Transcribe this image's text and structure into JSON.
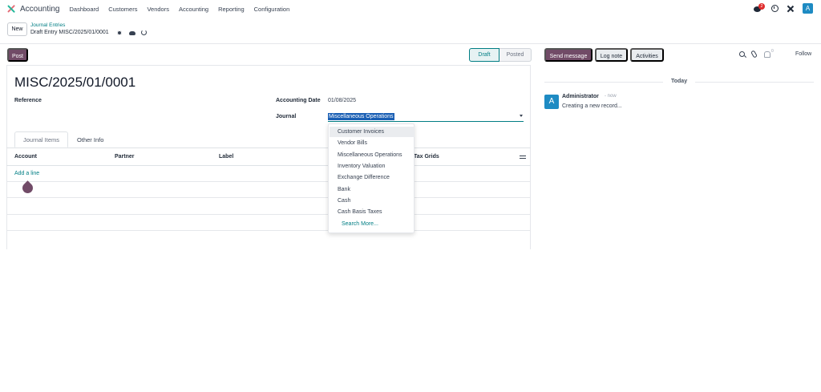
{
  "topnav": {
    "app_title": "Accounting",
    "menu": [
      "Dashboard",
      "Customers",
      "Vendors",
      "Accounting",
      "Reporting",
      "Configuration"
    ],
    "chat_count": "2",
    "avatar_letter": "A"
  },
  "control": {
    "new_label": "New",
    "breadcrumb_parent": "Journal Entries",
    "breadcrumb_current": "Draft Entry MISC/2025/01/0001"
  },
  "form": {
    "post_label": "Post",
    "status": {
      "draft": "Draft",
      "posted": "Posted",
      "current": "Draft"
    },
    "title": "MISC/2025/01/0001",
    "reference_label": "Reference",
    "accounting_date_label": "Accounting Date",
    "accounting_date_value": "01/08/2025",
    "journal_label": "Journal",
    "journal_value": "Miscellaneous Operations",
    "tabs": [
      "Journal Items",
      "Other Info"
    ],
    "columns": [
      "Account",
      "Partner",
      "Label",
      "Tax Grids"
    ],
    "add_line": "Add a line"
  },
  "dropdown": {
    "options": [
      "Customer Invoices",
      "Vendor Bills",
      "Miscellaneous Operations",
      "Inventory Valuation",
      "Exchange Difference",
      "Bank",
      "Cash",
      "Cash Basis Taxes"
    ],
    "search_more": "Search More..."
  },
  "chatter": {
    "send_message": "Send message",
    "log_note": "Log note",
    "activities": "Activities",
    "follower_count": "0",
    "follow": "Follow",
    "today": "Today",
    "message": {
      "avatar_letter": "A",
      "author": "Administrator",
      "time": "- now",
      "body": "Creating a new record..."
    }
  },
  "colors": {
    "brand": "#714b67",
    "accent": "#017e84",
    "badge": "#e02b2b",
    "avatar": "#1e8bc3"
  }
}
